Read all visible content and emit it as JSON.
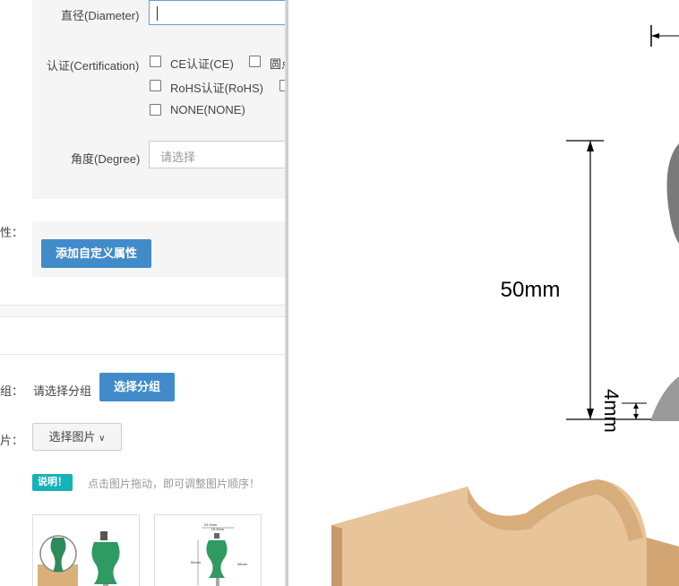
{
  "form": {
    "diameter_label": "直径(Diameter)",
    "diameter_value": "",
    "certification_label": "认证(Certification)",
    "cert_options": [
      {
        "label": "CE认证(CE)",
        "checked": false
      },
      {
        "label": "圆点",
        "checked": false
      },
      {
        "label": "RoHS认证(RoHS)",
        "checked": false
      },
      {
        "label": "",
        "checked": false
      },
      {
        "label": "NONE(NONE)",
        "checked": false
      }
    ],
    "degree_label": "角度(Degree)",
    "degree_placeholder": "请选择",
    "custom_attr_label": "性：",
    "add_custom_button": "添加自定义属性"
  },
  "group": {
    "label": "组：",
    "value": "请选择分组",
    "button": "选择分组"
  },
  "image": {
    "label": "片：",
    "button": "选择图片",
    "badge": "说明！",
    "hint": "点击图片拖动，即可调整图片顺序！"
  },
  "thumb2": {
    "top_dim": "24.0mm",
    "sub_dim": "15.9mm",
    "left_dim": "50mm",
    "right_dim": "38mm"
  },
  "drawing": {
    "height_label": "50mm",
    "small_label": "4mm"
  }
}
